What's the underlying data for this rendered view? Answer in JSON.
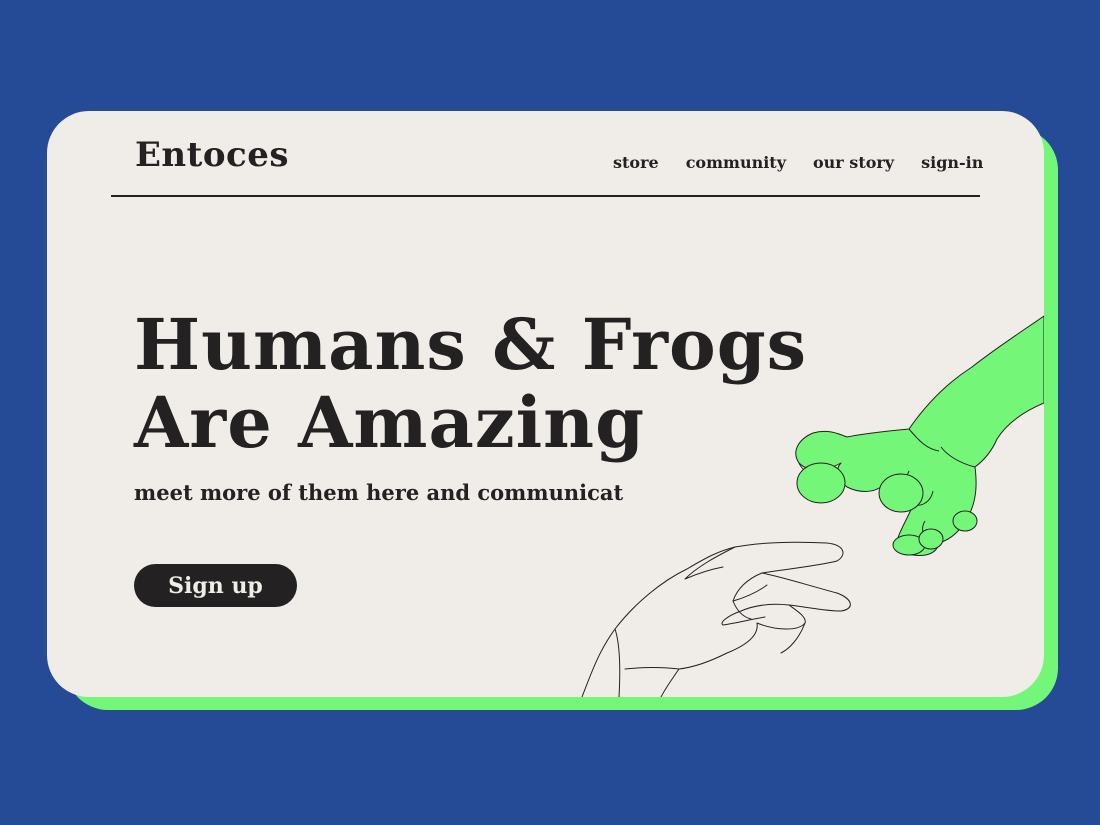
{
  "brand": {
    "name": "Entoces"
  },
  "nav": {
    "items": [
      {
        "label": "store"
      },
      {
        "label": "community"
      },
      {
        "label": "our story"
      },
      {
        "label": "sign-in"
      }
    ]
  },
  "hero": {
    "headline_line1": "Humans & Frogs",
    "headline_line2": "Are Amazing",
    "subheadline": "meet more of them here and communicat",
    "cta_label": "Sign up"
  },
  "colors": {
    "background": "#254b97",
    "card": "#f0ece8",
    "accent_green": "#74f779",
    "ink": "#232122"
  },
  "icons": {
    "human_hand": "human-hand-illustration",
    "frog_hand": "frog-hand-illustration"
  }
}
